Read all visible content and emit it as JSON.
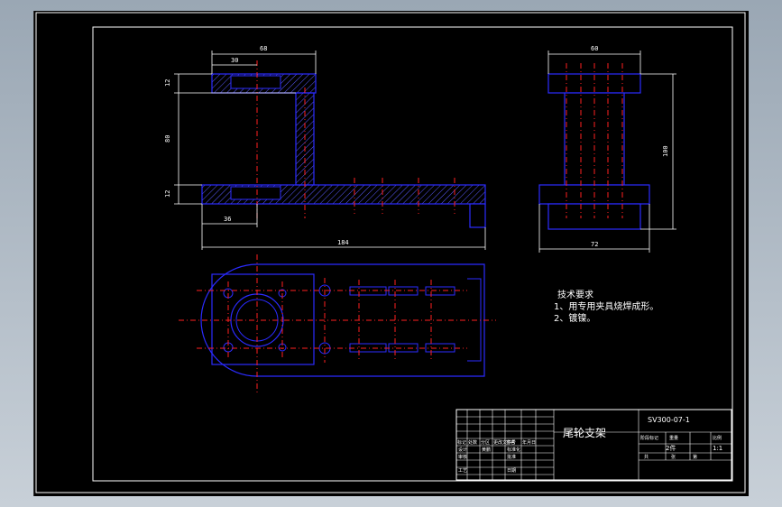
{
  "drawing": {
    "title": "尾轮支架",
    "code": "SV300-07-1",
    "notes_heading": "技术要求",
    "notes": [
      "1、用专用夹具烧焊成形。",
      "2、镀镍。"
    ]
  },
  "dimensions": {
    "top_overall_width": "68",
    "top_inner_width": "30",
    "top_plate_thickness": "12",
    "column_height": "80",
    "base_plate_thickness": "12",
    "base_left_width": "36",
    "total_length": "184",
    "side_width": "60",
    "side_height": "100",
    "side_base_width": "72"
  },
  "title_block": {
    "row_labels": [
      "标记",
      "处数",
      "分区",
      "更改文件号",
      "签名",
      "年月日"
    ],
    "design_label": "设计",
    "design_name": "黄鹏",
    "standardize_label": "标准化",
    "check_label": "审核",
    "process_label": "工艺",
    "approve_label": "批准",
    "date_label": "日期",
    "stage_label": "阶段标记",
    "weight_label": "重量",
    "scale_label": "比例",
    "scale_value": "1:1",
    "count_label": "共",
    "page_label": "张",
    "sheet_label": "第",
    "quantity_value": "2件"
  },
  "colors": {
    "background": "#000000",
    "outline": "#2b2bff",
    "centerline": "#ff2020",
    "dimension": "#ffffff",
    "hatch": "#5a5aff"
  }
}
